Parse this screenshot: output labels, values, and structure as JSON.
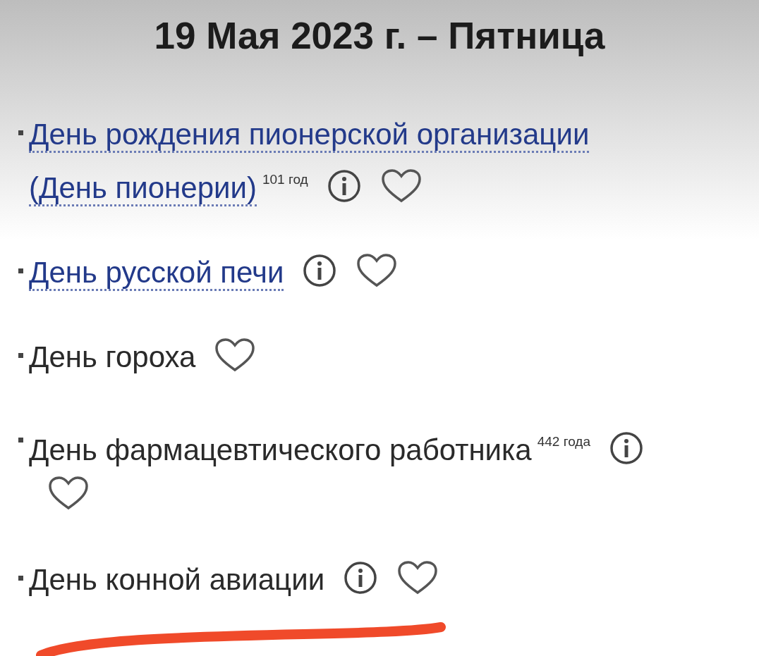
{
  "date_heading": "19 Мая 2023 г. – Пятница",
  "holidays": [
    {
      "kind": "link",
      "title_lines": [
        "День рождения пионерской организации",
        "(День пионерии)"
      ],
      "age": "101 год",
      "info": true
    },
    {
      "kind": "link",
      "title": "День русской печи",
      "info": true
    },
    {
      "kind": "plain",
      "title": "День гороха",
      "info": false
    },
    {
      "kind": "plain",
      "title": "День фармацевтического работника",
      "age": "442 года",
      "info": true
    },
    {
      "kind": "plain",
      "title": "День конной авиации",
      "info": true
    }
  ]
}
